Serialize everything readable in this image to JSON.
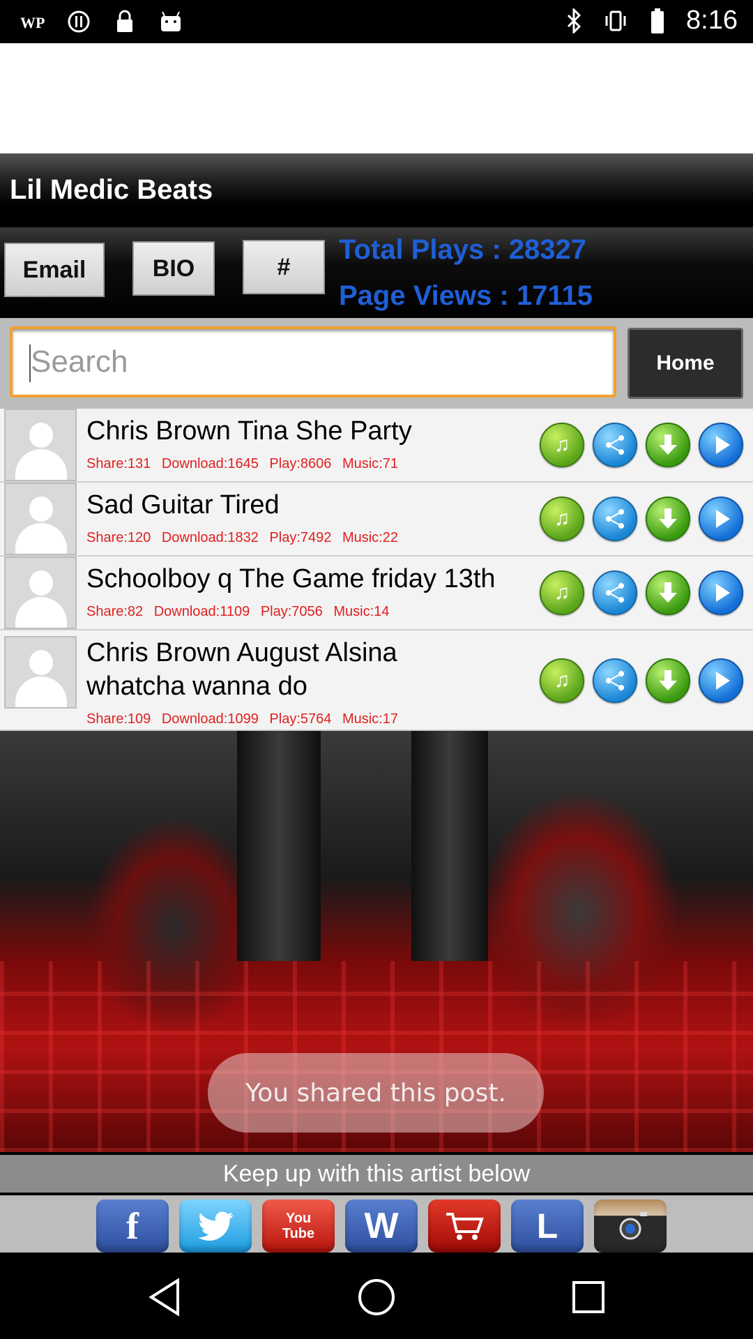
{
  "status_bar": {
    "time": "8:16",
    "left_icons": [
      "wp-icon",
      "alert-icon",
      "lock-icon",
      "android-icon"
    ],
    "right_icons": [
      "bluetooth-icon",
      "vibrate-icon",
      "battery-icon"
    ]
  },
  "header": {
    "title": "Lil Medic Beats"
  },
  "buttons": {
    "email": "Email",
    "bio": "BIO",
    "hash": "#"
  },
  "stats": {
    "total_plays": "Total Plays : 28327",
    "page_views": "Page Views : 17115"
  },
  "search": {
    "placeholder": "Search",
    "home_label": "Home"
  },
  "songs": [
    {
      "title": "Chris Brown Tina She Party",
      "share": "Share:131",
      "download": "Download:1645",
      "play": "Play:8606",
      "music": "Music:71"
    },
    {
      "title": "Sad Guitar Tired",
      "share": "Share:120",
      "download": "Download:1832",
      "play": "Play:7492",
      "music": "Music:22"
    },
    {
      "title": "Schoolboy q The Game friday 13th",
      "share": "Share:82",
      "download": "Download:1109",
      "play": "Play:7056",
      "music": "Music:14"
    },
    {
      "title": "Chris Brown August Alsina whatcha wanna do",
      "share": "Share:109",
      "download": "Download:1099",
      "play": "Play:5764",
      "music": "Music:17"
    }
  ],
  "toast": "You shared this post.",
  "follow_text": "Keep up with this artist below",
  "social": {
    "facebook": "f",
    "youtube_top": "You",
    "youtube_bottom": "Tube",
    "wordpress": "W",
    "l_label": "L"
  },
  "colors": {
    "accent_blue": "#1f5fd6",
    "stat_red": "#e02020",
    "search_border": "#f0a030"
  }
}
